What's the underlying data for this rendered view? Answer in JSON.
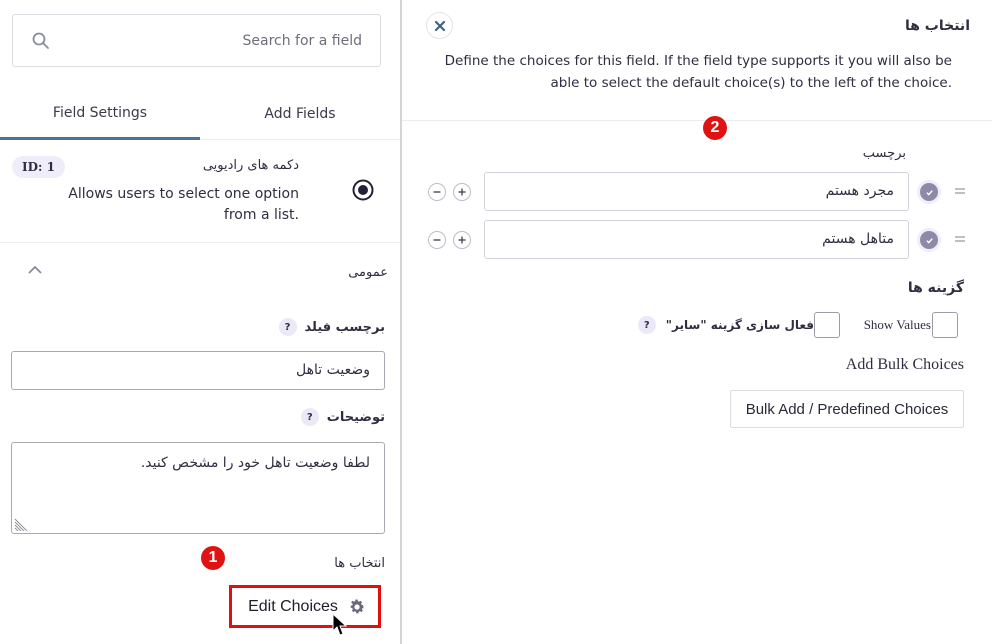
{
  "sidebar": {
    "search": {
      "placeholder": "Search for a field",
      "icon": "search-icon"
    },
    "tabs": [
      {
        "label": "Field Settings",
        "active": true
      },
      {
        "label": "Add Fields",
        "active": false
      }
    ],
    "field": {
      "id_badge": "ID: 1",
      "title": "دکمه های رادیویی",
      "description": "Allows users to select one option from a list.",
      "icon": "radio-button-icon"
    },
    "section": {
      "title": "عمومی",
      "expanded": true
    },
    "label_field": {
      "label": "برچسب فیلد",
      "help": "?",
      "value": "وضعیت تاهل"
    },
    "description_field": {
      "label": "توضیحات",
      "help": "?",
      "value": "لطفا وضعیت تاهل خود را مشخص کنید."
    },
    "choices": {
      "label": "انتخاب ها",
      "edit_button": "Edit Choices"
    }
  },
  "markers": {
    "one": "1",
    "two": "2"
  },
  "modal": {
    "title": "انتخاب ها",
    "description": "Define the choices for this field. If the field type supports it you will also be able to select the default choice(s) to the left of the choice.",
    "column_label": "برچسب",
    "choices": [
      {
        "label": "مجرد هستم",
        "default": true
      },
      {
        "label": "متاهل هستم",
        "default": true
      }
    ],
    "options_title": "گزینه ها",
    "show_values": {
      "label": "Show Values",
      "checked": false
    },
    "enable_other": {
      "label": "فعال سازی گزینه \"سایر\"",
      "checked": false,
      "help": "?"
    },
    "bulk_title": "Add Bulk Choices",
    "bulk_button": "Bulk Add / Predefined Choices"
  },
  "colors": {
    "accent_tab": "#4a7396",
    "marker_red": "#e01313",
    "highlight_red": "#e01010",
    "check_purple": "#8f89a8",
    "badge_bg": "#efedfa"
  }
}
